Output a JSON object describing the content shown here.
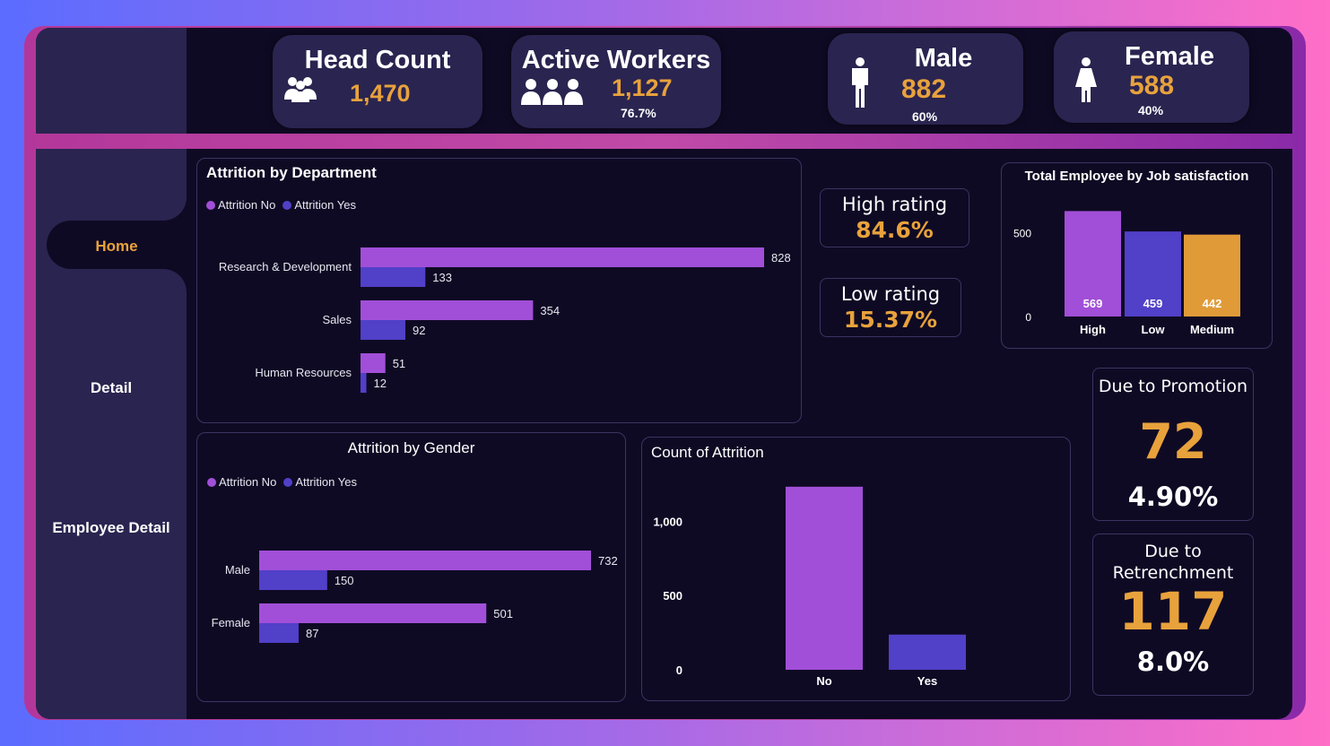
{
  "nav": {
    "home": "Home",
    "detail": "Detail",
    "employee_detail": "Employee Detail"
  },
  "kpis": {
    "head_count": {
      "title": "Head Count",
      "value": "1,470",
      "icon": "group-icon"
    },
    "active_workers": {
      "title": "Active Workers",
      "value": "1,127",
      "pct": "76.7%",
      "icon": "team-icon"
    },
    "male": {
      "title": "Male",
      "value": "882",
      "pct": "60%",
      "icon": "male-icon"
    },
    "female": {
      "title": "Female",
      "value": "588",
      "pct": "40%",
      "icon": "female-icon"
    }
  },
  "ratings": {
    "high": {
      "title": "High rating",
      "value": "84.6%"
    },
    "low": {
      "title": "Low rating",
      "value": "15.37%"
    }
  },
  "promotion": {
    "title": "Due to Promotion",
    "value": "72",
    "pct": "4.90%"
  },
  "retrenchment": {
    "title_line1": "Due to",
    "title_line2": "Retrenchment",
    "value": "117",
    "pct": "8.0%"
  },
  "colors": {
    "attrition_no": "#a14fd8",
    "attrition_yes": "#5140c8",
    "accent": "#e8a23c"
  },
  "chart_data": [
    {
      "id": "dept",
      "type": "bar",
      "orientation": "horizontal",
      "title": "Attrition by Department",
      "legend": [
        "Attrition No",
        "Attrition Yes"
      ],
      "categories": [
        "Research & Development",
        "Sales",
        "Human Resources"
      ],
      "series": [
        {
          "name": "Attrition No",
          "values": [
            828,
            354,
            51
          ]
        },
        {
          "name": "Attrition Yes",
          "values": [
            133,
            92,
            12
          ]
        }
      ]
    },
    {
      "id": "gender",
      "type": "bar",
      "orientation": "horizontal",
      "title": "Attrition by Gender",
      "legend": [
        "Attrition No",
        "Attrition Yes"
      ],
      "categories": [
        "Male",
        "Female"
      ],
      "series": [
        {
          "name": "Attrition No",
          "values": [
            732,
            501
          ]
        },
        {
          "name": "Attrition Yes",
          "values": [
            150,
            87
          ]
        }
      ]
    },
    {
      "id": "count",
      "type": "bar",
      "title": "Count of Attrition",
      "categories": [
        "No",
        "Yes"
      ],
      "values": [
        1233,
        237
      ],
      "yticks": [
        "0",
        "500",
        "1,000"
      ],
      "ylim": [
        0,
        1250
      ]
    },
    {
      "id": "jobsat",
      "type": "bar",
      "title": "Total Employee by Job satisfaction",
      "categories": [
        "High",
        "Low",
        "Medium"
      ],
      "values": [
        569,
        459,
        442
      ],
      "value_labels": [
        "569",
        "459",
        "442"
      ],
      "colors": [
        "#a14fd8",
        "#5140c8",
        "#e09a38"
      ],
      "yticks": [
        "0",
        "500"
      ],
      "ylim": [
        0,
        600
      ]
    }
  ]
}
